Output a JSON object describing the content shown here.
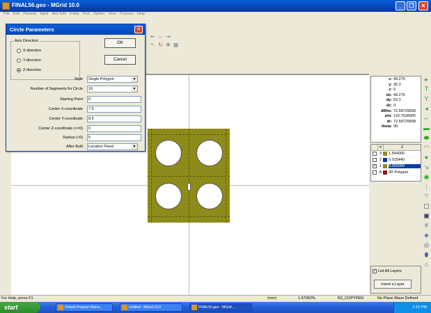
{
  "window": {
    "title": "FINAL56.geo - MGrid 10.0"
  },
  "menu": [
    "File",
    "Edit",
    "Params",
    "Input",
    "Adv Edit",
    "Entity",
    "Port",
    "Option",
    "View",
    "Process",
    "Help"
  ],
  "dialog": {
    "title": "Circle Parameters",
    "axis_group_label": "Axis Direction:",
    "axis_options": [
      "X-direction",
      "Y-direction",
      "Z-direction"
    ],
    "axis_selected": "Z-direction",
    "ok_label": "OK",
    "cancel_label": "Cancel",
    "fields": [
      {
        "label": "Style",
        "value": "Single Polygon",
        "kind": "select"
      },
      {
        "label": "Number of Segments for Circle",
        "value": "16",
        "kind": "select"
      },
      {
        "label": "Starting Point",
        "value": "0",
        "kind": "input"
      },
      {
        "label": "Center X-coordinate",
        "value": "7.5",
        "kind": "input"
      },
      {
        "label": "Center Y-coordinate",
        "value": "8.5",
        "kind": "input"
      },
      {
        "label": "Center Z-coordinate (<=0)",
        "value": "0",
        "kind": "input"
      },
      {
        "label": "Radius (>0)",
        "value": "5",
        "kind": "input"
      },
      {
        "label": "After Built",
        "value": "Location Fixed",
        "kind": "select"
      }
    ]
  },
  "coords": [
    {
      "k": "x:",
      "v": "49.275"
    },
    {
      "k": "y:",
      "v": "36.3"
    },
    {
      "k": "z:",
      "v": "0."
    },
    {
      "k": "dx:",
      "v": "49.275"
    },
    {
      "k": "dy:",
      "v": "53.3"
    },
    {
      "k": "dz:",
      "v": "0."
    },
    {
      "k": "dRho:",
      "v": "72.58729658"
    },
    {
      "k": "phi:",
      "v": "132.7528905"
    },
    {
      "k": "dr:",
      "v": "72.58729658"
    },
    {
      "k": "theta:",
      "v": "90."
    }
  ],
  "layers": {
    "header": [
      "",
      "#",
      "Z"
    ],
    "rows": [
      {
        "checked": false,
        "num": "3",
        "color": "#8d8b19",
        "value": "1.544000",
        "selected": false
      },
      {
        "checked": false,
        "num": "2",
        "color": "#0a3a9a",
        "value": "0.015440",
        "selected": false
      },
      {
        "checked": true,
        "num": "1",
        "color": "#8d8b19",
        "value": "0.000000",
        "selected": true
      },
      {
        "checked": false,
        "num": "A",
        "color": "#8b1a1a",
        "value": "3D Polygon",
        "selected": false
      }
    ]
  },
  "list_all_layers": "List All Layers",
  "insert_layer": "Insert a Layer",
  "status": {
    "help": "For Help, press F1",
    "unit": "(mm)",
    "zoom": "1.67962%",
    "mode": "R2_COPYPEN",
    "wave": "No Plane Wave Defined"
  },
  "taskbar": {
    "start": "start",
    "tasks": [
      "Zeland Program Mana...",
      "Untitled - MGrid 10.0",
      "FINAL56.geo - MGrid ..."
    ],
    "clock": "2:16 PM"
  },
  "colors": {
    "conductor": "#8d8b19",
    "titlebar": "#0845b8"
  }
}
